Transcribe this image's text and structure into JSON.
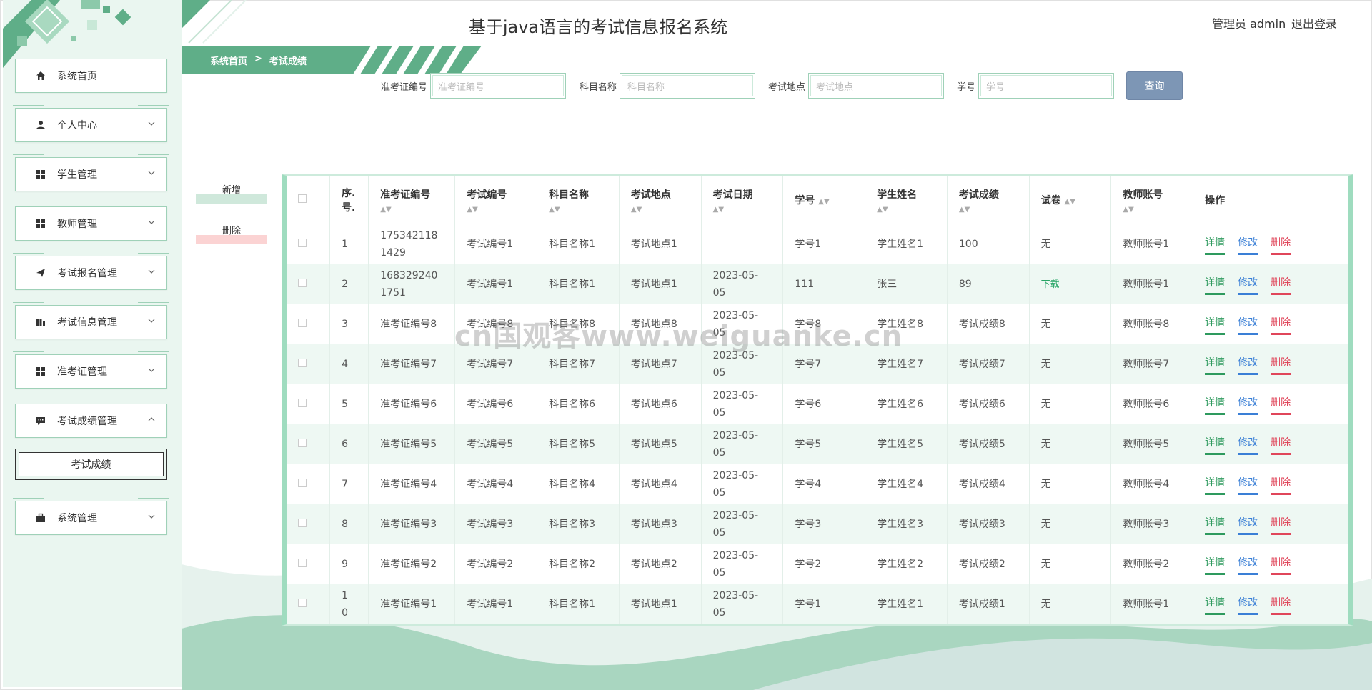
{
  "header": {
    "title": "基于java语言的考试信息报名系统",
    "user": "管理员 admin",
    "logout": "退出登录"
  },
  "breadcrumb": {
    "home": "系统首页",
    "sep": ">",
    "current": "考试成绩"
  },
  "sidebar": {
    "items": [
      {
        "label": "系统首页",
        "icon": "home-icon"
      },
      {
        "label": "个人中心",
        "icon": "user-icon"
      },
      {
        "label": "学生管理",
        "icon": "grid-icon"
      },
      {
        "label": "教师管理",
        "icon": "grid-icon"
      },
      {
        "label": "考试报名管理",
        "icon": "send-icon"
      },
      {
        "label": "考试信息管理",
        "icon": "chart-icon"
      },
      {
        "label": "准考证管理",
        "icon": "grid-icon"
      },
      {
        "label": "考试成绩管理",
        "icon": "message-icon"
      },
      {
        "label": "系统管理",
        "icon": "briefcase-icon"
      }
    ],
    "sub_item": "考试成绩"
  },
  "search": {
    "f1_label": "准考证编号",
    "f1_placeholder": "准考证编号",
    "f2_label": "科目名称",
    "f2_placeholder": "科目名称",
    "f3_label": "考试地点",
    "f3_placeholder": "考试地点",
    "f4_label": "学号",
    "f4_placeholder": "学号",
    "query": "查询"
  },
  "actions": {
    "add": "新增",
    "delete": "删除"
  },
  "table": {
    "headers": [
      "序.号.",
      "准考证编号",
      "考试编号",
      "科目名称",
      "考试地点",
      "考试日期",
      "学号",
      "学生姓名",
      "考试成绩",
      "试卷",
      "教师账号",
      "操作"
    ],
    "op_labels": {
      "detail": "详情",
      "edit": "修改",
      "remove": "删除"
    },
    "rows": [
      {
        "no": "1",
        "ticket": "1753421181429",
        "exam": "考试编号1",
        "subject": "科目名称1",
        "place": "考试地点1",
        "date": "",
        "sid": "学号1",
        "sname": "学生姓名1",
        "score": "100",
        "paper": "无",
        "teacher": "教师账号1"
      },
      {
        "no": "2",
        "ticket": "1683292401751",
        "exam": "考试编号1",
        "subject": "科目名称1",
        "place": "考试地点1",
        "date": "2023-05-05",
        "sid": "111",
        "sname": "张三",
        "score": "89",
        "paper": "下载",
        "teacher": "教师账号1"
      },
      {
        "no": "3",
        "ticket": "准考证编号8",
        "exam": "考试编号8",
        "subject": "科目名称8",
        "place": "考试地点8",
        "date": "2023-05-05",
        "sid": "学号8",
        "sname": "学生姓名8",
        "score": "考试成绩8",
        "paper": "无",
        "teacher": "教师账号8"
      },
      {
        "no": "4",
        "ticket": "准考证编号7",
        "exam": "考试编号7",
        "subject": "科目名称7",
        "place": "考试地点7",
        "date": "2023-05-05",
        "sid": "学号7",
        "sname": "学生姓名7",
        "score": "考试成绩7",
        "paper": "无",
        "teacher": "教师账号7"
      },
      {
        "no": "5",
        "ticket": "准考证编号6",
        "exam": "考试编号6",
        "subject": "科目名称6",
        "place": "考试地点6",
        "date": "2023-05-05",
        "sid": "学号6",
        "sname": "学生姓名6",
        "score": "考试成绩6",
        "paper": "无",
        "teacher": "教师账号6"
      },
      {
        "no": "6",
        "ticket": "准考证编号5",
        "exam": "考试编号5",
        "subject": "科目名称5",
        "place": "考试地点5",
        "date": "2023-05-05",
        "sid": "学号5",
        "sname": "学生姓名5",
        "score": "考试成绩5",
        "paper": "无",
        "teacher": "教师账号5"
      },
      {
        "no": "7",
        "ticket": "准考证编号4",
        "exam": "考试编号4",
        "subject": "科目名称4",
        "place": "考试地点4",
        "date": "2023-05-05",
        "sid": "学号4",
        "sname": "学生姓名4",
        "score": "考试成绩4",
        "paper": "无",
        "teacher": "教师账号4"
      },
      {
        "no": "8",
        "ticket": "准考证编号3",
        "exam": "考试编号3",
        "subject": "科目名称3",
        "place": "考试地点3",
        "date": "2023-05-05",
        "sid": "学号3",
        "sname": "学生姓名3",
        "score": "考试成绩3",
        "paper": "无",
        "teacher": "教师账号3"
      },
      {
        "no": "9",
        "ticket": "准考证编号2",
        "exam": "考试编号2",
        "subject": "科目名称2",
        "place": "考试地点2",
        "date": "2023-05-05",
        "sid": "学号2",
        "sname": "学生姓名2",
        "score": "考试成绩2",
        "paper": "无",
        "teacher": "教师账号2"
      },
      {
        "no": "10",
        "ticket": "准考证编号1",
        "exam": "考试编号1",
        "subject": "科目名称1",
        "place": "考试地点1",
        "date": "2023-05-05",
        "sid": "学号1",
        "sname": "学生姓名1",
        "score": "考试成绩1",
        "paper": "无",
        "teacher": "教师账号1"
      }
    ]
  },
  "watermark": "cn国观客www.weiguanke.cn",
  "colors": {
    "accent": "#5fae88",
    "sidebar_bg": "#eaf6f0",
    "query_btn": "#7d96b5",
    "delete_red": "#e0465a",
    "edit_blue": "#3a7fd6"
  }
}
